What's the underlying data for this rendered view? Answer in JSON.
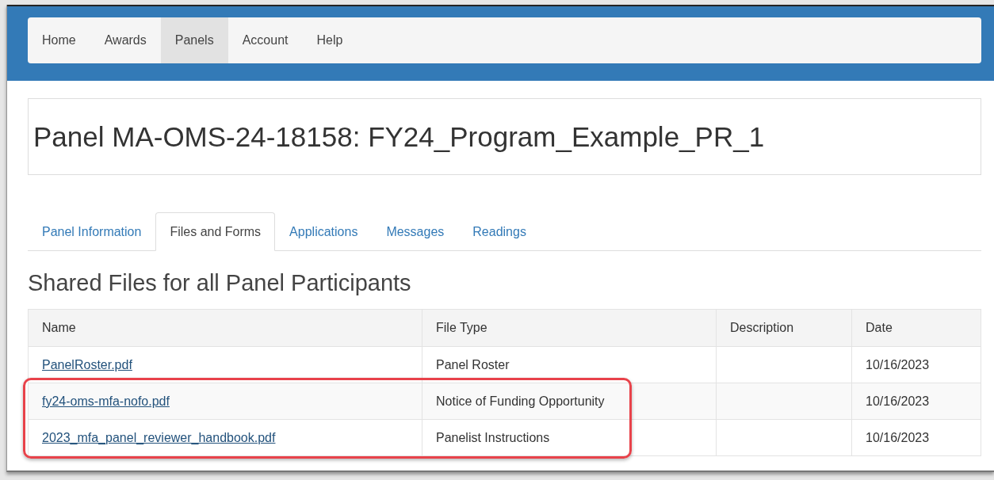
{
  "navbar": {
    "items": [
      {
        "label": "Home",
        "selected": false
      },
      {
        "label": "Awards",
        "selected": false
      },
      {
        "label": "Panels",
        "selected": true
      },
      {
        "label": "Account",
        "selected": false
      },
      {
        "label": "Help",
        "selected": false
      }
    ]
  },
  "page_title": "Panel MA-OMS-24-18158: FY24_Program_Example_PR_1",
  "tabs": [
    {
      "label": "Panel Information",
      "selected": false
    },
    {
      "label": "Files and Forms",
      "selected": true
    },
    {
      "label": "Applications",
      "selected": false
    },
    {
      "label": "Messages",
      "selected": false
    },
    {
      "label": "Readings",
      "selected": false
    }
  ],
  "section_heading": "Shared Files for all Panel Participants",
  "table": {
    "columns": [
      "Name",
      "File Type",
      "Description",
      "Date"
    ],
    "rows": [
      {
        "name": "PanelRoster.pdf",
        "file_type": "Panel Roster",
        "date": "10/16/2023",
        "highlighted": false
      },
      {
        "name": "fy24-oms-mfa-nofo.pdf",
        "file_type": "Notice of Funding Opportunity",
        "date": "10/16/2023",
        "highlighted": true
      },
      {
        "name": "2023_mfa_panel_reviewer_handbook.pdf",
        "file_type": "Panelist Instructions",
        "date": "10/16/2023",
        "highlighted": true
      }
    ]
  }
}
